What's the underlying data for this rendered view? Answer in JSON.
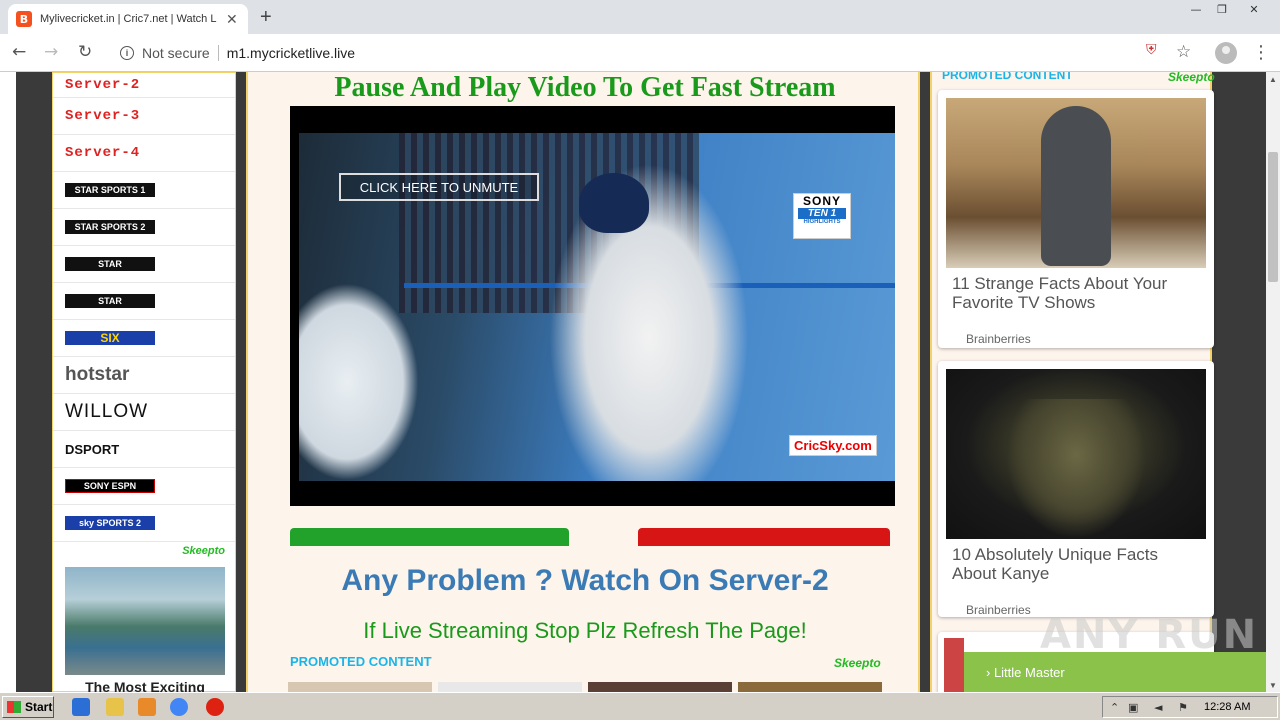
{
  "browser": {
    "tab_title": "Mylivecricket.in | Cric7.net | Watch L",
    "tab_favicon": "B",
    "not_secure": "Not secure",
    "url": "m1.mycricketlive.live"
  },
  "left_sidebar": {
    "servers": [
      "Server-2",
      "Server-3",
      "Server-4"
    ],
    "channels": [
      {
        "name": "star-sports-1",
        "label": "STAR SPORTS 1",
        "color": "#000000"
      },
      {
        "name": "star-sports-2",
        "label": "STAR SPORTS 2",
        "color": "#000000"
      },
      {
        "name": "star-sports-3",
        "label": "STAR",
        "color": "#000000"
      },
      {
        "name": "star-sports-4",
        "label": "STAR",
        "color": "#000000"
      },
      {
        "name": "ten-six",
        "label": "SIX",
        "color": "#1a3fa8"
      },
      {
        "name": "hotstar",
        "label": "hotstar",
        "color": "#ffffff"
      },
      {
        "name": "willow",
        "label": "WILLOW",
        "color": "#ffffff"
      },
      {
        "name": "dsport",
        "label": "DSPORT",
        "color": "#ffffff"
      },
      {
        "name": "sony-espn",
        "label": "SONY ESPN",
        "color": "#000000"
      },
      {
        "name": "sky-sports-2",
        "label": "sky SPORTS 2",
        "color": "#1a3fa8"
      }
    ],
    "ad": {
      "logo": "Skeepto",
      "text": "The Most Exciting"
    }
  },
  "main": {
    "headline": "Pause And Play Video To Get Fast Stream",
    "unmute_label": "CLICK HERE TO UNMUTE",
    "sony_top": "SONY",
    "sony_ten": "TEN 1",
    "sony_hl": "HIGHLIGHTS",
    "watermark_site": "CricSky.com",
    "problem_text": "Any Problem ? Watch On Server-2",
    "refresh_text": "If Live Streaming Stop Plz Refresh The Page!",
    "promoted_label": "PROMOTED CONTENT",
    "promoted_logo": "Skeepto"
  },
  "right_sidebar": {
    "promoted_label": "PROMOTED CONTENT",
    "logo": "Skeepto",
    "cards": [
      {
        "title": "11 Strange Facts About Your Favorite TV Shows",
        "source": "Brainberries"
      },
      {
        "title": "10 Absolutely Unique Facts About Kanye",
        "source": "Brainberries"
      }
    ],
    "bottom_bar": "› Little Master"
  },
  "overlay": {
    "watermark": "ANY RUN"
  },
  "taskbar": {
    "start": "Start",
    "clock": "12:28 AM"
  }
}
